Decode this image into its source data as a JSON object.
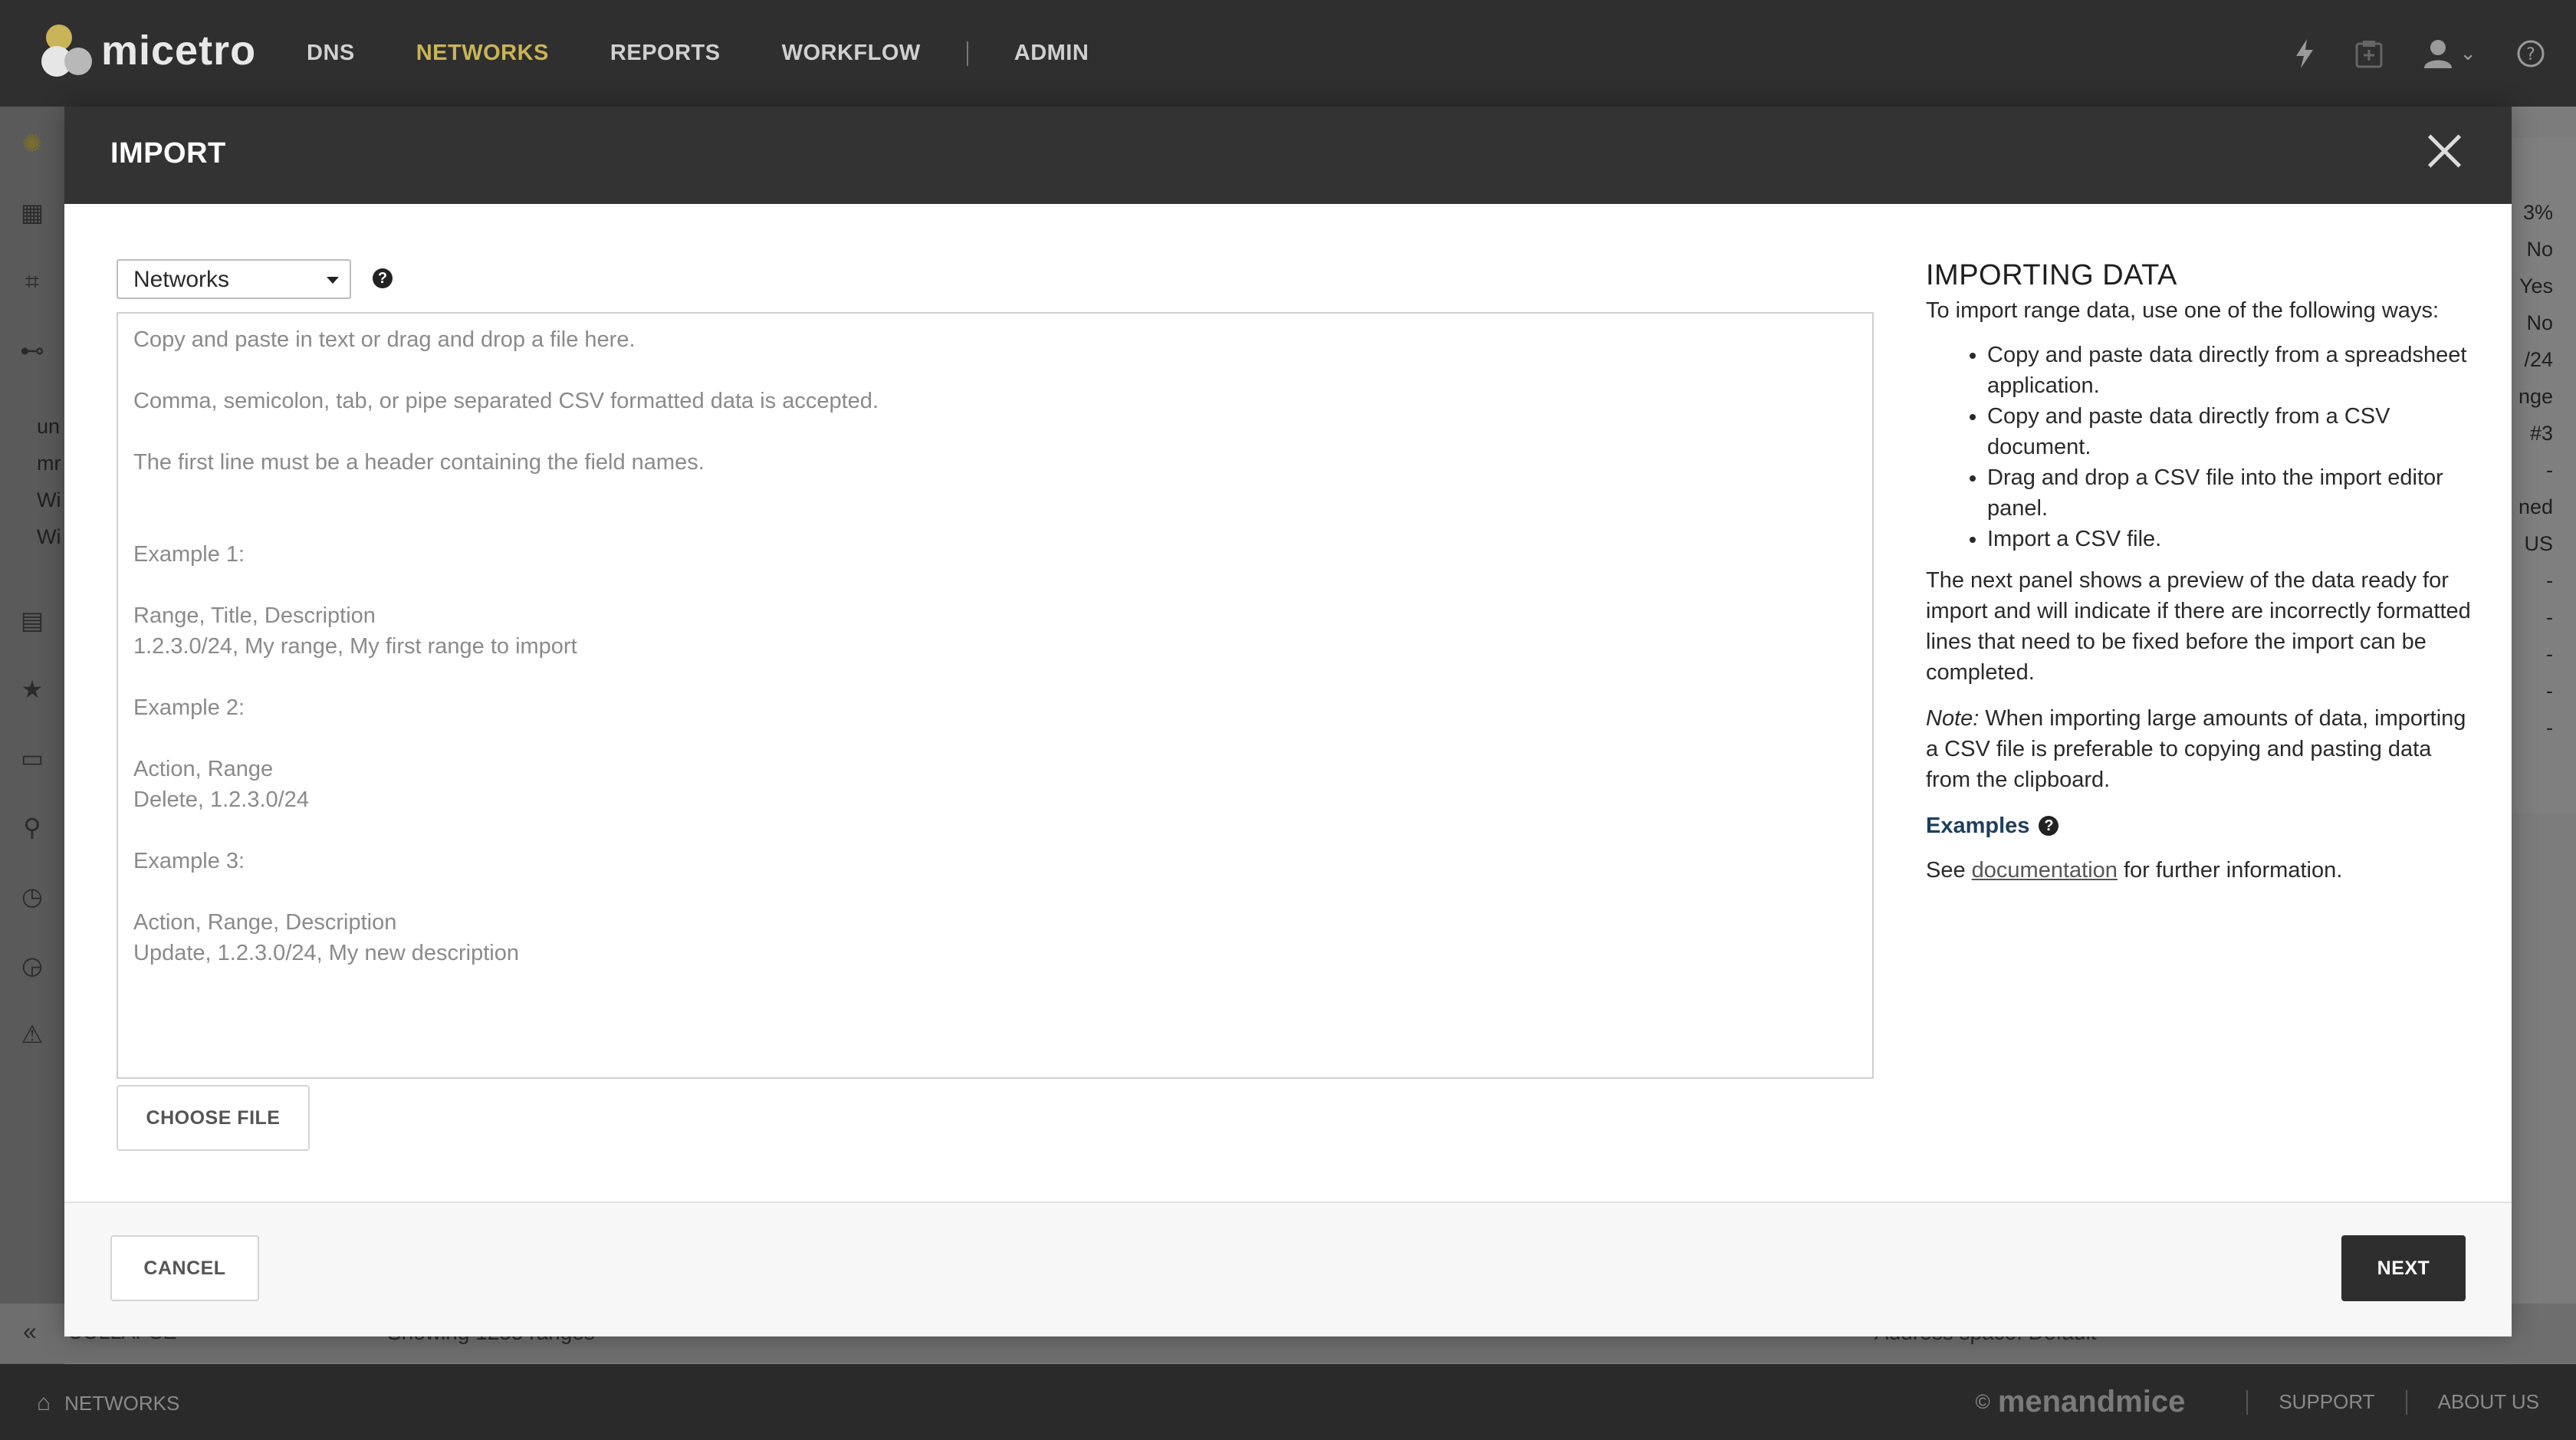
{
  "app": {
    "name": "micetro"
  },
  "nav": {
    "items": [
      {
        "label": "DNS",
        "active": false
      },
      {
        "label": "NETWORKS",
        "active": true
      },
      {
        "label": "REPORTS",
        "active": false
      },
      {
        "label": "WORKFLOW",
        "active": false
      },
      {
        "label": "ADMIN",
        "active": false
      }
    ],
    "icons": [
      "bolt-icon",
      "task-icon",
      "user-icon",
      "help-icon"
    ]
  },
  "background": {
    "list_items": [
      "un",
      "mr",
      "Wi",
      "Wi"
    ],
    "right_cells": [
      "3%",
      "No",
      "Yes",
      "No",
      "/24",
      "nge",
      "#3",
      "-",
      "ned",
      "US",
      "-",
      "-",
      "-",
      "-",
      "-"
    ],
    "collapse_label": "COLLAPSE",
    "showing_text": "Showing 1255 ranges",
    "address_space_text": "Address space: Default"
  },
  "modal": {
    "title": "IMPORT",
    "type_select": {
      "value": "Networks",
      "options": [
        "Networks"
      ]
    },
    "editor_lines": [
      "Copy and paste in text or drag and drop a file here.",
      "",
      "Comma, semicolon, tab, or pipe separated CSV formatted data is accepted.",
      "",
      "The first line must be a header containing the field names.",
      "",
      "",
      "Example 1:",
      "",
      "Range, Title, Description",
      "1.2.3.0/24, My range, My first range to import",
      "",
      "Example 2:",
      "",
      "Action, Range",
      "Delete, 1.2.3.0/24",
      "",
      "Example 3:",
      "",
      "Action, Range, Description",
      "Update, 1.2.3.0/24, My new description"
    ],
    "choose_file_label": "CHOOSE FILE",
    "info": {
      "title": "IMPORTING DATA",
      "intro": "To import range data, use one of the following ways:",
      "bullets": [
        "Copy and paste data directly from a spreadsheet application.",
        "Copy and paste data directly from a CSV document.",
        "Drag and drop a CSV file into the import editor panel.",
        "Import a CSV file."
      ],
      "preview_text": "The next panel shows a preview of the data ready for import and will indicate if there are incorrectly formatted lines that need to be fixed before the import can be completed.",
      "note_label": "Note:",
      "note_text": " When importing large amounts of data, importing a CSV file is preferable to copying and pasting data from the clipboard.",
      "examples_label": "Examples",
      "see_prefix": "See ",
      "doc_link": "documentation",
      "see_suffix": " for further information."
    },
    "cancel_label": "CANCEL",
    "next_label": "NEXT"
  },
  "footer": {
    "breadcrumb": "NETWORKS",
    "copyright": "©",
    "brand": "menandmice",
    "links": [
      "SUPPORT",
      "ABOUT US"
    ]
  }
}
